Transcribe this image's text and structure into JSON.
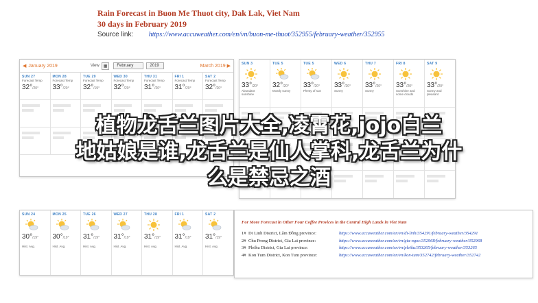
{
  "header": {
    "title": "Rain Forecast in Buon Me Thuot city, Dak Lak, Viet Nam",
    "subtitle": "30 days in February 2019",
    "source_label": "Source link:",
    "source_url": "https://www.accuweather.com/en/vn/buon-me-thuot/352955/february-weather/352955"
  },
  "calendar_bar": {
    "prev_month": "January 2019",
    "view_label": "View",
    "month_select": "February",
    "year_select": "2019",
    "next_month": "March 2019"
  },
  "top_left_cells": [
    {
      "label": "SUN 27",
      "desc": "Forecast Temp",
      "temp": "32°",
      "lo": "/20°"
    },
    {
      "label": "MON 28",
      "desc": "Forecast Temp",
      "temp": "33°",
      "lo": "/20°"
    },
    {
      "label": "TUE 29",
      "desc": "Forecast Temp",
      "temp": "32°",
      "lo": "/19°"
    },
    {
      "label": "WED 30",
      "desc": "Forecast Temp",
      "temp": "32°",
      "lo": "/20°"
    },
    {
      "label": "THU 31",
      "desc": "Forecast Temp",
      "temp": "31°",
      "lo": "/20°"
    },
    {
      "label": "FRI 1",
      "desc": "Forecast Temp",
      "temp": "31°",
      "lo": "/20°"
    },
    {
      "label": "SAT 2",
      "desc": "Forecast Temp",
      "temp": "32°",
      "lo": "/20°"
    }
  ],
  "top_right_cells": [
    {
      "label": "SUN 3",
      "temp": "33°",
      "lo": "/20°",
      "desc": "Abundant sunshine"
    },
    {
      "label": "TUE 5",
      "temp": "32°",
      "lo": "/20°",
      "desc": "Mostly sunny"
    },
    {
      "label": "TUE 5",
      "temp": "33°",
      "lo": "/20°",
      "desc": "Plenty of sun"
    },
    {
      "label": "WED 6",
      "temp": "33°",
      "lo": "/20°",
      "desc": "Sunny"
    },
    {
      "label": "THU 7",
      "temp": "33°",
      "lo": "/20°",
      "desc": "Sunny"
    },
    {
      "label": "FRI 8",
      "temp": "33°",
      "lo": "/20°",
      "desc": "Sunshine and some clouds"
    },
    {
      "label": "SAT 9",
      "temp": "33°",
      "lo": "/20°",
      "desc": "Sunny and pleasant"
    }
  ],
  "bottom_cells": [
    {
      "label": "SUN 24",
      "temp": "30°",
      "lo": "/19°",
      "desc": "Hist. Avg."
    },
    {
      "label": "MON 25",
      "temp": "30°",
      "lo": "/19°",
      "desc": "Hist. Avg."
    },
    {
      "label": "TUE 26",
      "temp": "31°",
      "lo": "/19°",
      "desc": "Hist. Avg."
    },
    {
      "label": "WED 27",
      "temp": "31°",
      "lo": "/19°",
      "desc": "Hist. Avg."
    },
    {
      "label": "THU 28",
      "temp": "31°",
      "lo": "/19°",
      "desc": "Hist. Avg."
    },
    {
      "label": "FRI 1",
      "temp": "31°",
      "lo": "/19°",
      "desc": "Hist. Avg."
    },
    {
      "label": "SAT 2",
      "temp": "31°",
      "lo": "/19°",
      "desc": "Hist. Avg."
    }
  ],
  "more_forecast": {
    "title": "For More Forecast in Other Four Coffee Provices in the Central High Lands in Viet Nam",
    "items": [
      {
        "num": "1#",
        "district": "Di Linh District, Lâm Đồng province:",
        "url": "https://www.accuweather.com/en/vn/di-linh/354291/february-weather/354291"
      },
      {
        "num": "2#",
        "district": "Chu Prong District, Gia Lai province:",
        "url": "https://www.accuweather.com/en/vn/gia-ngoc/352968/february-weather/352968"
      },
      {
        "num": "3#",
        "district": "Pleiku District, Gia Lai province:",
        "url": "https://www.accuweather.com/en/vn/pleiku/353265/february-weather/353265"
      },
      {
        "num": "4#",
        "district": "Kon Tum District, Kon Tum province:",
        "url": "https://www.accuweather.com/en/vn/kon-tum/352742/february-weather/352742"
      }
    ]
  },
  "overlay": {
    "line1": "植物龙舌兰图片大全,凌霄花,jojo白兰",
    "line2": "地姑娘是谁,龙舌兰是仙人掌科,龙舌兰为什",
    "line3": "么是禁忌之酒"
  }
}
